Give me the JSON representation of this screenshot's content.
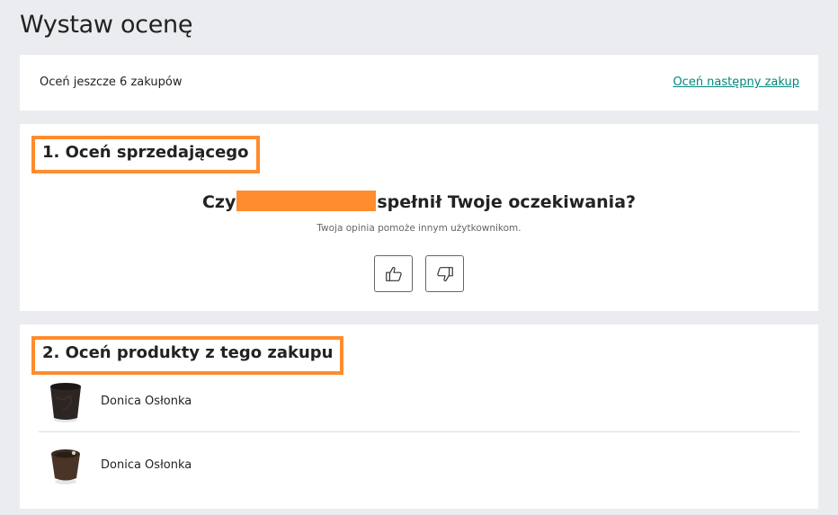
{
  "page": {
    "title": "Wystaw ocenę"
  },
  "remaining": {
    "text": "Oceń jeszcze 6 zakupów",
    "next_link": "Oceń następny zakup"
  },
  "seller_section": {
    "heading": "1. Oceń sprzedającego",
    "question_prefix": "Czy",
    "question_suffix": "spełnił Twoje oczekiwania?",
    "helper": "Twoja opinia pomoże innym użytkownikom.",
    "buttons": [
      {
        "icon": "thumbs-up-icon"
      },
      {
        "icon": "thumbs-down-icon"
      }
    ]
  },
  "products_section": {
    "heading": "2. Oceń produkty z tego zakupu",
    "items": [
      {
        "name": "Donica Osłonka",
        "image": "black-planter-image"
      },
      {
        "name": "Donica Osłonka",
        "image": "brown-planter-image"
      }
    ]
  },
  "colors": {
    "highlight": "#ff8c2f",
    "link": "#00877a",
    "background": "#eaecef"
  }
}
